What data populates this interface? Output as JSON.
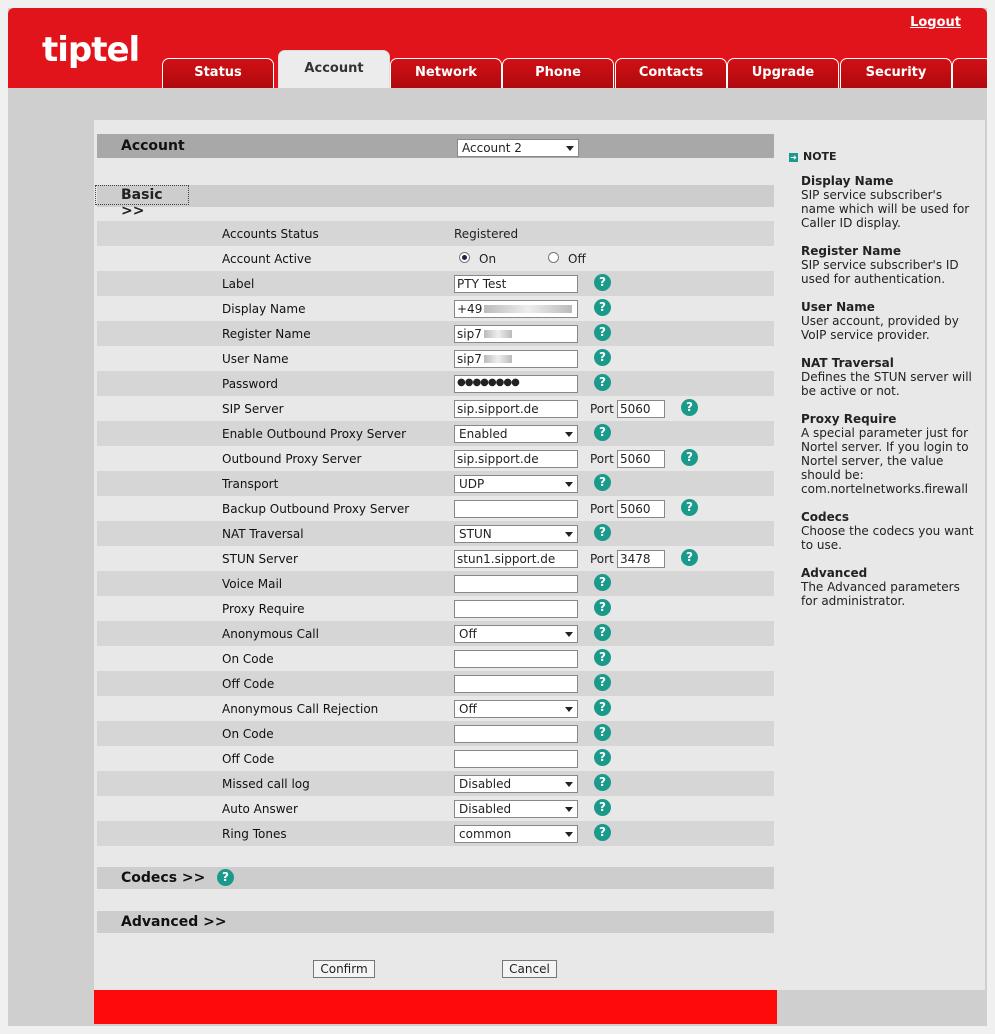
{
  "header": {
    "logo": "tiptel",
    "logout": "Logout",
    "tabs": [
      "Status",
      "Account",
      "Network",
      "Phone",
      "Contacts",
      "Upgrade",
      "Security"
    ],
    "active_tab": "Account"
  },
  "account": {
    "title": "Account",
    "selected": "Account 2"
  },
  "basic_label": "Basic >>",
  "fields": {
    "accounts_status": {
      "label": "Accounts Status",
      "value": "Registered"
    },
    "account_active": {
      "label": "Account Active",
      "on": "On",
      "off": "Off",
      "selected": "On"
    },
    "label": {
      "label": "Label",
      "value": "PTY Test"
    },
    "display_name": {
      "label": "Display Name",
      "value": "+49"
    },
    "register_name": {
      "label": "Register Name",
      "value": "sip7"
    },
    "user_name": {
      "label": "User Name",
      "value": "sip7"
    },
    "password": {
      "label": "Password",
      "value": "●●●●●●●●"
    },
    "sip_server": {
      "label": "SIP Server",
      "value": "sip.sipport.de",
      "port_label": "Port",
      "port": "5060"
    },
    "enable_outbound": {
      "label": "Enable Outbound Proxy Server",
      "value": "Enabled"
    },
    "outbound_proxy": {
      "label": "Outbound Proxy Server",
      "value": "sip.sipport.de",
      "port_label": "Port",
      "port": "5060"
    },
    "transport": {
      "label": "Transport",
      "value": "UDP"
    },
    "backup_outbound": {
      "label": "Backup Outbound Proxy Server",
      "value": "",
      "port_label": "Port",
      "port": "5060"
    },
    "nat_traversal": {
      "label": "NAT Traversal",
      "value": "STUN"
    },
    "stun_server": {
      "label": "STUN Server",
      "value": "stun1.sipport.de",
      "port_label": "Port",
      "port": "3478"
    },
    "voice_mail": {
      "label": "Voice Mail",
      "value": ""
    },
    "proxy_require": {
      "label": "Proxy Require",
      "value": ""
    },
    "anonymous_call": {
      "label": "Anonymous Call",
      "value": "Off"
    },
    "on_code_1": {
      "label": "On Code",
      "value": ""
    },
    "off_code_1": {
      "label": "Off Code",
      "value": ""
    },
    "anonymous_rejection": {
      "label": "Anonymous Call Rejection",
      "value": "Off"
    },
    "on_code_2": {
      "label": "On Code",
      "value": ""
    },
    "off_code_2": {
      "label": "Off Code",
      "value": ""
    },
    "missed_call_log": {
      "label": "Missed call log",
      "value": "Disabled"
    },
    "auto_answer": {
      "label": "Auto Answer",
      "value": "Disabled"
    },
    "ring_tones": {
      "label": "Ring Tones",
      "value": "common"
    }
  },
  "codecs_label": "Codecs >>",
  "advanced_label": "Advanced >>",
  "buttons": {
    "confirm": "Confirm",
    "cancel": "Cancel"
  },
  "help_glyph": "?",
  "notes": {
    "title": "NOTE",
    "items": [
      {
        "heading": "Display Name",
        "text": "SIP service subscriber's name which will be used for Caller ID display."
      },
      {
        "heading": "Register Name",
        "text": "SIP service subscriber's ID used for authentication."
      },
      {
        "heading": "User Name",
        "text": "User account, provided by VoIP service provider."
      },
      {
        "heading": "NAT Traversal",
        "text": "Defines the STUN server will be active or not."
      },
      {
        "heading": "Proxy Require",
        "text": "A special parameter just for Nortel server. If you login to Nortel server, the value should be: com.nortelnetworks.firewall"
      },
      {
        "heading": "Codecs",
        "text": "Choose the codecs you want to use."
      },
      {
        "heading": "Advanced",
        "text": "The Advanced parameters for administrator."
      }
    ]
  },
  "colors": {
    "brand_red": "#e0141a",
    "help_teal": "#1a9a8a"
  }
}
